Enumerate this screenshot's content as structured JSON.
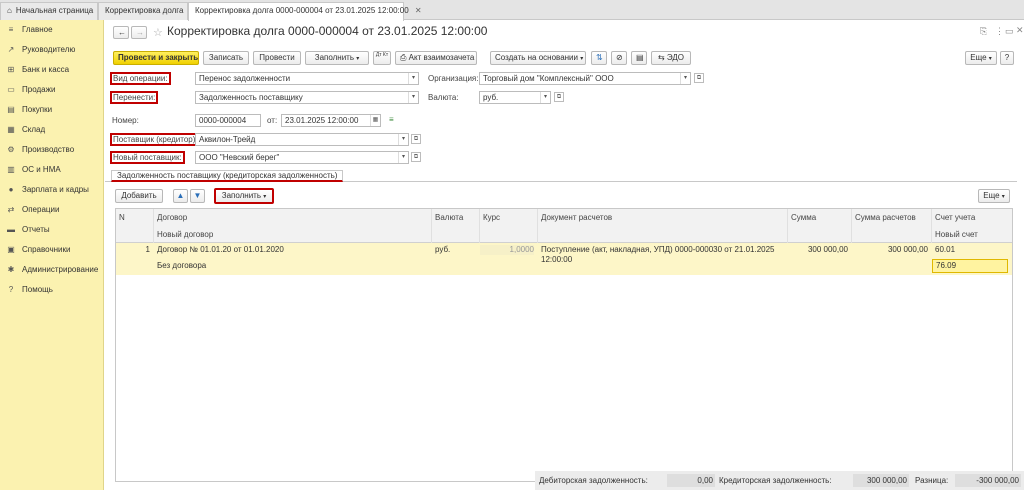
{
  "tabs": {
    "home": "Начальная страница",
    "tab1": "Корректировка долга",
    "tab2": "Корректировка долга 0000-000004 от 23.01.2025 12:00:00"
  },
  "sidebar": [
    {
      "icon": "hamburger-icon",
      "glyph": "≡",
      "label": "Главное"
    },
    {
      "icon": "trend-icon",
      "glyph": "↗",
      "label": "Руководителю"
    },
    {
      "icon": "bank-icon",
      "glyph": "⊞",
      "label": "Банк и касса"
    },
    {
      "icon": "cart-icon",
      "glyph": "▭",
      "label": "Продажи"
    },
    {
      "icon": "basket-icon",
      "glyph": "▤",
      "label": "Покупки"
    },
    {
      "icon": "warehouse-icon",
      "glyph": "▦",
      "label": "Склад"
    },
    {
      "icon": "factory-icon",
      "glyph": "⚙",
      "label": "Производство"
    },
    {
      "icon": "assets-icon",
      "glyph": "▥",
      "label": "ОС и НМА"
    },
    {
      "icon": "person-icon",
      "glyph": "●",
      "label": "Зарплата и кадры"
    },
    {
      "icon": "operations-icon",
      "glyph": "⇄",
      "label": "Операции"
    },
    {
      "icon": "reports-icon",
      "glyph": "▬",
      "label": "Отчеты"
    },
    {
      "icon": "book-icon",
      "glyph": "▣",
      "label": "Справочники"
    },
    {
      "icon": "gear-icon",
      "glyph": "✱",
      "label": "Администрирование"
    },
    {
      "icon": "help-icon",
      "glyph": "?",
      "label": "Помощь"
    }
  ],
  "header": {
    "title": "Корректировка долга 0000-000004 от 23.01.2025 12:00:00"
  },
  "toolbar": {
    "post_close": "Провести и закрыть",
    "save": "Записать",
    "post": "Провести",
    "fill": "Заполнить",
    "dt_kt": "Дт Кт",
    "act": "Акт взаимозачета",
    "create_based": "Создать на основании",
    "edo": "ЭДО",
    "more": "Еще"
  },
  "form": {
    "op_type_label": "Вид операции:",
    "op_type_value": "Перенос задолженности",
    "transfer_label": "Перенести:",
    "transfer_value": "Задолженность поставщику",
    "org_label": "Организация:",
    "org_value": "Торговый дом \"Комплексный\" ООО",
    "currency_label": "Валюта:",
    "currency_value": "руб.",
    "number_label": "Номер:",
    "number_value": "0000-000004",
    "date_label": "от:",
    "date_value": "23.01.2025 12:00:00",
    "supplier_label": "Поставщик (кредитор):",
    "supplier_value": "Аквилон-Трейд",
    "new_supplier_label": "Новый поставщик:",
    "new_supplier_value": "ООО \"Невский берег\""
  },
  "section_tab": "Задолженность поставщику (кредиторская задолженность)",
  "table_toolbar": {
    "add": "Добавить",
    "fill": "Заполнить",
    "more": "Еще"
  },
  "table": {
    "headers": {
      "n": "N",
      "contract": "Договор",
      "new_contract": "Новый договор",
      "currency": "Валюта",
      "rate": "Курс",
      "doc": "Документ расчетов",
      "sum": "Сумма",
      "sum_settle": "Сумма расчетов",
      "account": "Счет учета",
      "new_account": "Новый счет"
    },
    "rows": [
      {
        "n": "1",
        "contract": "Договор № 01.01.20 от 01.01.2020",
        "new_contract": "Без договора",
        "currency": "руб.",
        "rate": "1,0000",
        "doc_line1": "Поступление (акт, накладная, УПД) 0000-000030 от 21.01.2025",
        "doc_line2": "12:00:00",
        "sum": "300 000,00",
        "sum_settle": "300 000,00",
        "account": "60.01",
        "new_account": "76.09"
      }
    ]
  },
  "footer": {
    "debit_label": "Дебиторская задолженность:",
    "debit_value": "0,00",
    "credit_label": "Кредиторская задолженность:",
    "credit_value": "300 000,00",
    "diff_label": "Разница:",
    "diff_value": "-300 000,00"
  },
  "colors": {
    "sidebar_bg": "#fbf2b0",
    "primary_button": "#f5d900",
    "highlight_red": "#c00000",
    "selected_row": "#fdf6c8"
  }
}
